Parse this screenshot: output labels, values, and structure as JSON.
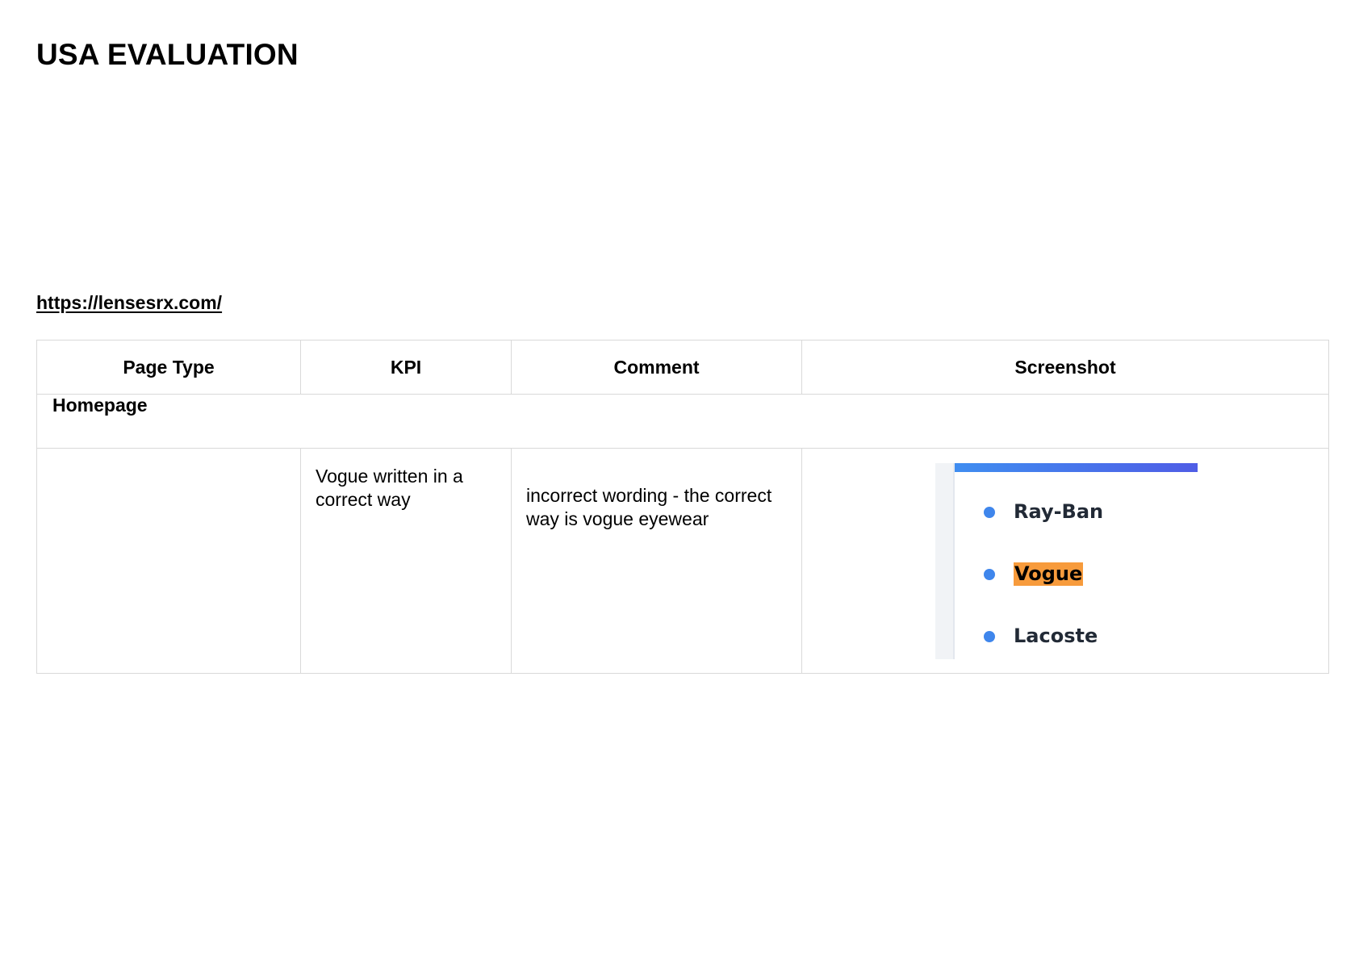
{
  "document": {
    "title": "USA EVALUATION",
    "site_url": "https://lensesrx.com/"
  },
  "table": {
    "headers": [
      "Page Type",
      "KPI",
      "Comment",
      "Screenshot"
    ],
    "section": "Homepage",
    "rows": [
      {
        "page_type": "",
        "kpi": "Vogue written in a correct way",
        "comment": "incorrect wording - the correct way is vogue eyewear",
        "screenshot": {
          "brands": [
            "Ray-Ban",
            "Vogue",
            "Lacoste"
          ],
          "highlighted_brand": "Vogue",
          "highlight_color": "#f79b3c",
          "bullet_color": "#3f86ec",
          "bar_gradient": [
            "#3f8df0",
            "#4f5de6"
          ]
        }
      }
    ]
  }
}
